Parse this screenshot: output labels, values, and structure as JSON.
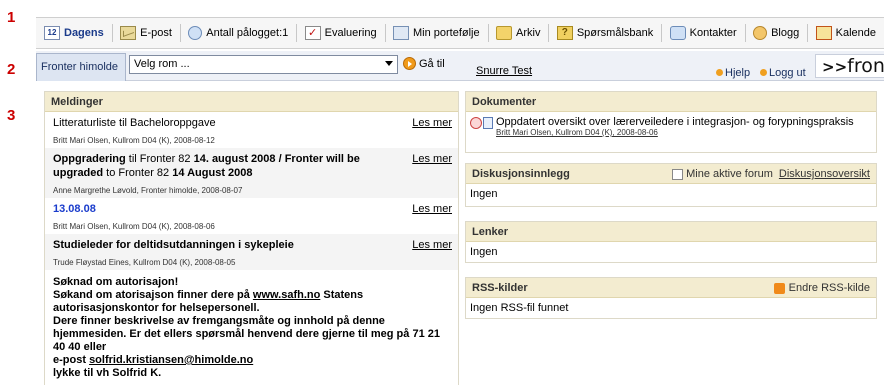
{
  "markers": [
    "1",
    "2",
    "3"
  ],
  "toolbar": {
    "items": [
      {
        "label": "Dagens",
        "icon": "calendar-day-icon",
        "badge": "12"
      },
      {
        "label": "E-post",
        "icon": "mail-icon"
      },
      {
        "label": "Antall pålogget:1",
        "icon": "users-online-icon"
      },
      {
        "label": "Evaluering",
        "icon": "checkbox-icon"
      },
      {
        "label": "Min portefølje",
        "icon": "portfolio-icon"
      },
      {
        "label": "Arkiv",
        "icon": "folder-icon"
      },
      {
        "label": "Spørsmålsbank",
        "icon": "question-icon"
      },
      {
        "label": "Kontakter",
        "icon": "contacts-icon"
      },
      {
        "label": "Blogg",
        "icon": "blog-icon"
      },
      {
        "label": "Kalende",
        "icon": "calendar-icon"
      }
    ]
  },
  "nav": {
    "tab": "Fronter himolde",
    "room_select": "Velg rom ...",
    "goto": "Gå til",
    "user_link": "Snurre Test",
    "help": "Hjelp",
    "logout": "Logg ut",
    "logo": "fronte",
    "logo_prefix": ">>"
  },
  "meldinger": {
    "title": "Meldinger",
    "read_more": "Les mer",
    "items": [
      {
        "title": "Litteraturliste til Bacheloroppgave",
        "meta": "Britt Mari Olsen,  Kullrom D04 (K),  2008-08-12"
      },
      {
        "title_a": "Oppgradering",
        "title_b": " til Fronter 82 ",
        "title_c": "14. august 2008 / Fronter will be upgraded",
        "title_d": " to Fronter 82 ",
        "title_e": "14 August 2008",
        "meta": "Anne Margrethe Løvold,  Fronter himolde,  2008-08-07"
      },
      {
        "title": "13.08.08",
        "meta": "Britt Mari Olsen,  Kullrom D04 (K),  2008-08-06"
      },
      {
        "title": "Studieleder for deltidsutdanningen i sykepleie",
        "meta": "Trude Fløystad Eines,  Kullrom D04 (K),  2008-08-05"
      }
    ],
    "long": {
      "l1": "Søknad om autorisajon!",
      "l2a": "Søkand om atorisajson finner dere på ",
      "l2link": "www.safh.no",
      "l2b": " Statens",
      "l3": "autorisasjonskontor for helsepersonell.",
      "l4": "Dere finner beskrivelse av fremgangsmåte og innhold på denne",
      "l5": "hjemmesiden.  Er det ellers spørsmål henvend dere gjerne til meg på 71 21",
      "l6": "40 40 eller",
      "l7a": "e-post ",
      "l7link": "solfrid.kristiansen@himolde.no",
      "l8": "lykke til vh Solfrid K."
    }
  },
  "dokumenter": {
    "title": "Dokumenter",
    "doc_title": "Oppdatert oversikt over lærerveiledere i integrasjon- og forypningspraksis",
    "doc_meta": "Britt Mari Olsen,  Kullrom D04 (K),  2008-08-06"
  },
  "diskusjon": {
    "title": "Diskusjonsinnlegg",
    "checkbox_label": "Mine aktive forum",
    "link": "Diskusjonsoversikt",
    "empty": "Ingen"
  },
  "lenker": {
    "title": "Lenker",
    "empty": "Ingen"
  },
  "rss": {
    "title": "RSS-kilder",
    "edit": "Endre RSS-kilde",
    "empty": "Ingen RSS-fil funnet"
  }
}
